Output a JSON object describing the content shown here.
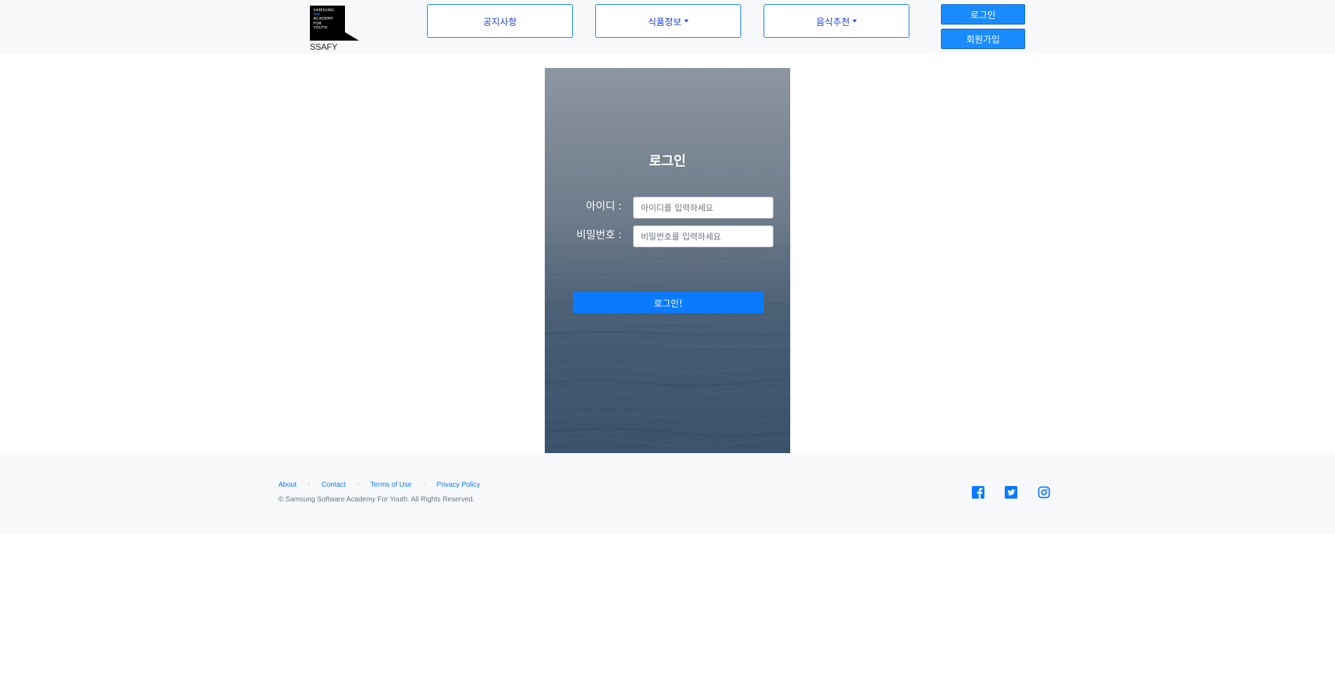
{
  "header": {
    "logo_lines": [
      "SAMSUNG",
      "SW",
      "ACADEMY",
      "FOR",
      "YOUTH"
    ],
    "logo_text": "SSAFY",
    "nav": [
      {
        "label": "공지사항",
        "dropdown": false
      },
      {
        "label": "식품정보",
        "dropdown": true
      },
      {
        "label": "음식추천",
        "dropdown": true
      }
    ],
    "login_label": "로그인",
    "signup_label": "회원가입"
  },
  "login": {
    "title": "로그인",
    "id_label": "아이디 :",
    "id_placeholder": "아이디를 입력하세요",
    "pw_label": "비밀번호 :",
    "pw_placeholder": "비밀번호를 입력하세요",
    "submit_label": "로그인!"
  },
  "footer": {
    "links": [
      "About",
      "Contact",
      "Terms of Use",
      "Privacy Policy"
    ],
    "separator": "·",
    "copyright": "© Samsung Software Academy For Youth. All Rights Reserved.",
    "social_icons": [
      "facebook-icon",
      "twitter-icon",
      "instagram-icon"
    ]
  },
  "colors": {
    "accent": "#0a7bff",
    "nav_text": "#1f3fd8",
    "background_light": "#f7f8fa"
  }
}
